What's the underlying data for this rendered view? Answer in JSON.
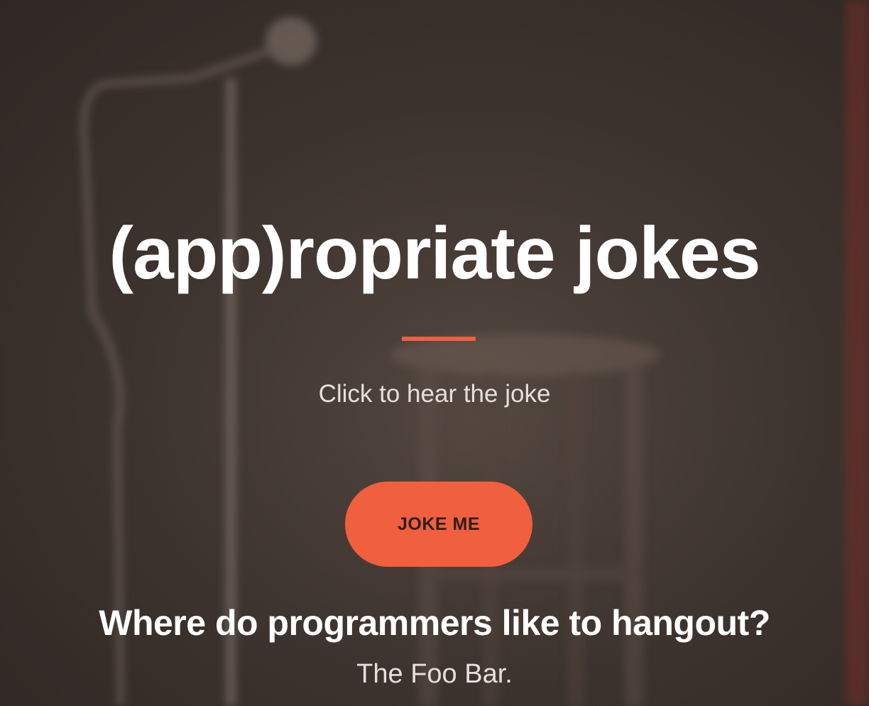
{
  "hero": {
    "title": "(app)ropriate jokes",
    "subtitle": "Click to hear the joke",
    "button_label": "JOKE ME",
    "accent_color": "#f05f3e"
  },
  "joke": {
    "question": "Where do programmers like to hangout?",
    "answer": "The Foo Bar."
  }
}
